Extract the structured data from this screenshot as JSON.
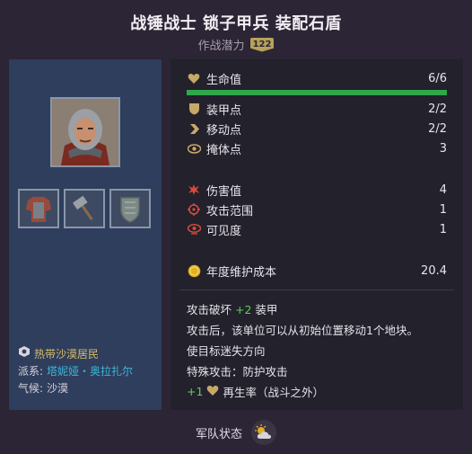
{
  "header": {
    "title": "战锤战士 锁子甲兵 装配石盾",
    "subtitle": "作战潜力",
    "rank": "122"
  },
  "unit": {
    "portrait_icon": "armored-warrior-portrait",
    "equipment": [
      {
        "icon": "chainmail-armor-icon"
      },
      {
        "icon": "warhammer-icon"
      },
      {
        "icon": "stone-shield-icon"
      }
    ]
  },
  "culture": {
    "name": "热带沙漠居民",
    "faction_label": "派系:",
    "faction_value": "塔妮娅・奥拉扎尔",
    "climate_label": "气候:",
    "climate_value": "沙漠"
  },
  "stats": {
    "hp": {
      "label": "生命值",
      "value": "6/6",
      "fill": 1.0
    },
    "armor": {
      "label": "装甲点",
      "value": "2/2"
    },
    "move": {
      "label": "移动点",
      "value": "2/2"
    },
    "cover": {
      "label": "掩体点",
      "value": "3"
    },
    "damage": {
      "label": "伤害值",
      "value": "4"
    },
    "range": {
      "label": "攻击范围",
      "value": "1"
    },
    "vision": {
      "label": "可见度",
      "value": "1"
    },
    "upkeep": {
      "label": "年度维护成本",
      "value": "20.4"
    }
  },
  "abilities": {
    "a1_pre": "攻击破坏",
    "a1_num": "+2",
    "a1_post": "装甲",
    "a2": "攻击后，该单位可以从初始位置移动1个地块。",
    "a3": "使目标迷失方向",
    "a4": "特殊攻击：防护攻击",
    "a5_num": "+1",
    "a5_post": "再生率（战斗之外）"
  },
  "footer": {
    "label": "军队状态",
    "icon": "weather-sun-cloud-icon"
  },
  "colors": {
    "background": "#2b2535",
    "left_panel": "#2e3e5c",
    "right_panel": "#23212b",
    "hp_bar": "#2fa84a",
    "link": "#3fb6d8",
    "green": "#5cd05a",
    "gold": "#d8bd6a"
  }
}
